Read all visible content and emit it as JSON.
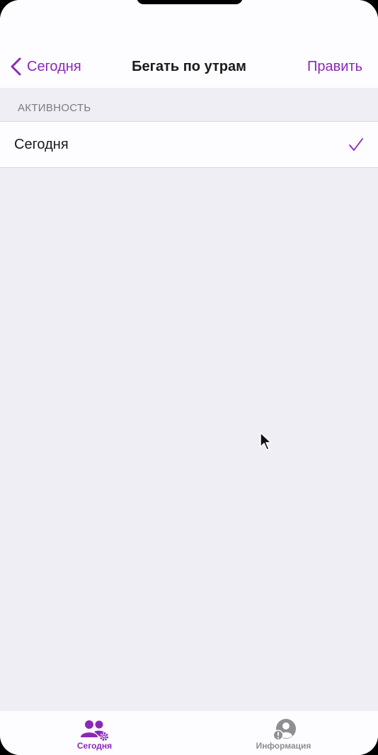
{
  "nav": {
    "back_label": "Сегодня",
    "title": "Бегать по утрам",
    "edit_label": "Править"
  },
  "section": {
    "header": "АКТИВНОСТЬ",
    "items": [
      {
        "label": "Сегодня",
        "checked": true
      }
    ]
  },
  "tabbar": {
    "tabs": [
      {
        "label": "Сегодня",
        "icon": "people-gear-icon",
        "active": true
      },
      {
        "label": "Информация",
        "icon": "person-info-icon",
        "active": false
      }
    ]
  },
  "colors": {
    "accent": "#8c28b8",
    "background": "#efeef5",
    "bar": "#fdfcfe",
    "inactive": "#8e8e93"
  }
}
